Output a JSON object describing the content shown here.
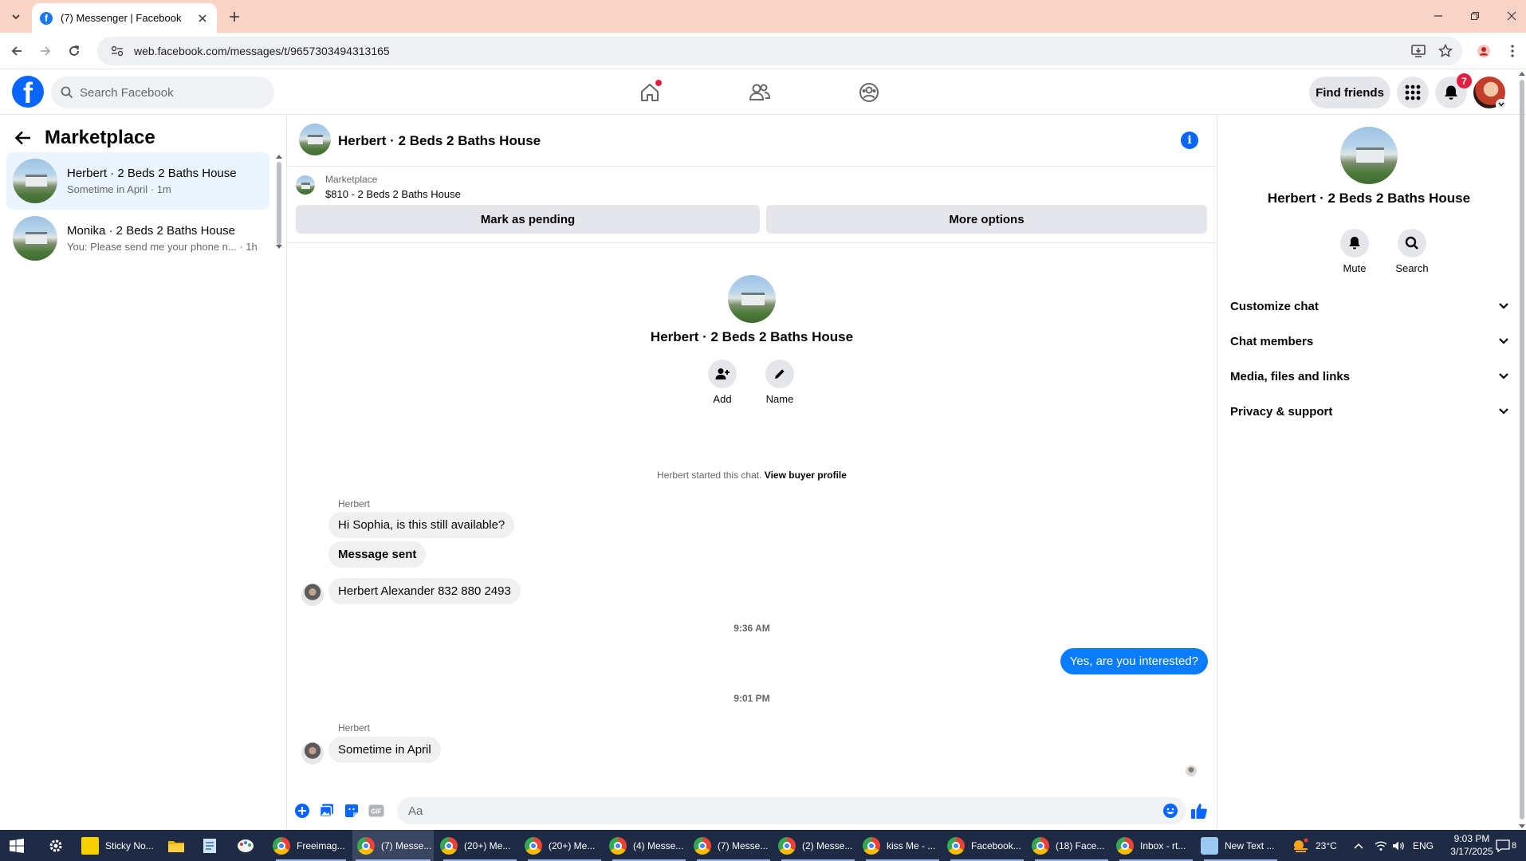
{
  "browser": {
    "tab_title": "(7) Messenger | Facebook",
    "url": "web.facebook.com/messages/t/9657303494313165"
  },
  "fb_header": {
    "search_placeholder": "Search Facebook",
    "find_friends": "Find friends",
    "notifications_count": "7"
  },
  "left_panel": {
    "title": "Marketplace",
    "conversations": [
      {
        "name": "Herbert · 2 Beds 2 Baths House",
        "preview": "Sometime in April · 1m",
        "active": true
      },
      {
        "name": "Monika · 2 Beds 2 Baths House",
        "preview": "You: Please send me your phone n... · 1h",
        "active": false
      }
    ]
  },
  "chat": {
    "title": "Herbert · 2 Beds 2 Baths House",
    "marketplace_label": "Marketplace",
    "listing": "$810 - 2 Beds 2 Baths House",
    "mark_pending": "Mark as pending",
    "more_options": "More options",
    "intro_name": "Herbert · 2 Beds 2 Baths House",
    "intro_actions": {
      "add": "Add",
      "name": "Name"
    },
    "started_text": "Herbert started this chat.",
    "view_buyer_profile": "View buyer profile",
    "messages": [
      {
        "sender": "Herbert",
        "text": "Hi Sophia, is this still available?"
      },
      {
        "text": "Message sent"
      },
      {
        "text": "Herbert Alexander 832 880 2493"
      },
      {
        "timestamp": "9:36 AM"
      },
      {
        "outgoing": true,
        "text": "Yes, are you interested?"
      },
      {
        "timestamp": "9:01 PM"
      },
      {
        "sender": "Herbert",
        "text": "Sometime in April"
      }
    ],
    "composer_placeholder": "Aa"
  },
  "right_panel": {
    "name": "Herbert · 2 Beds 2 Baths House",
    "mute": "Mute",
    "search": "Search",
    "sections": [
      "Customize chat",
      "Chat members",
      "Media, files and links",
      "Privacy & support"
    ]
  },
  "taskbar": {
    "items": [
      "Sticky No...",
      "Freeimag...",
      "(7) Messe...",
      "(20+) Me...",
      "(20+) Me...",
      "(4) Messe...",
      "(7) Messe...",
      "(2) Messe...",
      "kiss Me - ...",
      "Facebook...",
      "(18) Face...",
      "Inbox - rt...",
      "New Text ..."
    ],
    "temperature": "23°C",
    "language": "ENG",
    "time": "9:03 PM",
    "date": "3/17/2025",
    "notification_count": "8"
  },
  "colors": {
    "fb_blue": "#0866ff",
    "messenger_blue": "#0a7cff",
    "tab_bg": "#f9d4c6"
  }
}
